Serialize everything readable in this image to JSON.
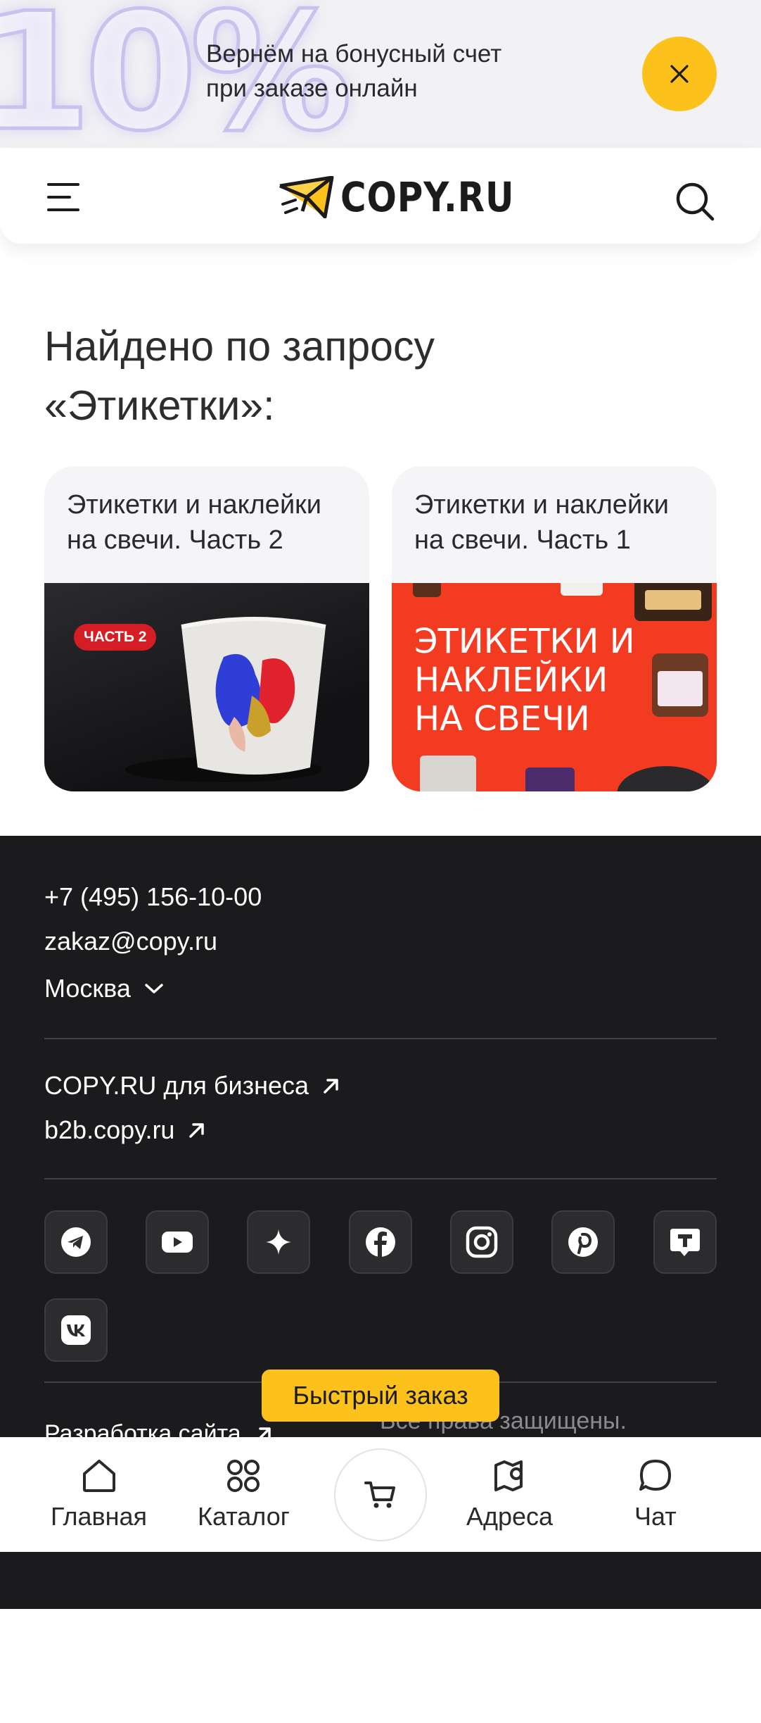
{
  "promo": {
    "big_text": "10%",
    "line1": "Вернём на бонусный счет",
    "line2": "при заказе онлайн",
    "close_icon": "close-icon",
    "accent_color": "#fdc11b"
  },
  "header": {
    "brand": "COPY.RU",
    "menu_icon": "menu-icon",
    "search_icon": "search-icon"
  },
  "results": {
    "title_line1": "Найдено по запросу",
    "title_line2": "«Этикетки»:",
    "cards": [
      {
        "title": "Этикетки и наклейки на свечи. Часть 2",
        "badge": "ЧАСТЬ 2",
        "image_text": ""
      },
      {
        "title": "Этикетки и наклейки на свечи. Часть 1",
        "badge": "",
        "image_text": "ЭТИКЕТКИ И НАКЛЕЙКИ НА СВЕЧИ"
      }
    ]
  },
  "footer": {
    "phone": "+7 (495) 156-10-00",
    "email": "zakaz@copy.ru",
    "city": "Москва",
    "business_link": "COPY.RU для бизнеса",
    "b2b_link": "b2b.copy.ru",
    "socials": [
      "telegram-icon",
      "youtube-icon",
      "sparkle-icon",
      "facebook-icon",
      "instagram-icon",
      "pinterest-icon",
      "tenchat-icon",
      "vk-icon"
    ],
    "dev_link": "Разработка сайта",
    "rights": "Все права защищены."
  },
  "quick_order": "Быстрый заказ",
  "nav": {
    "home": "Главная",
    "catalog": "Каталог",
    "cart_icon": "cart-icon",
    "addresses": "Адреса",
    "chat": "Чат"
  }
}
